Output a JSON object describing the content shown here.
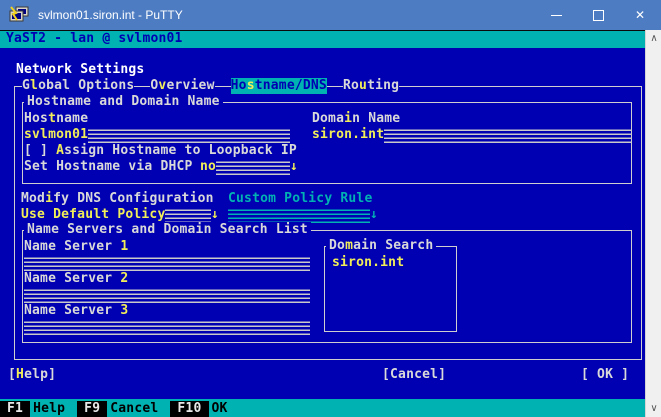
{
  "colors": {
    "titlebar": "#4d7cc2",
    "terminal_bg": "#0000b2",
    "cyan": "#00b2b2",
    "yellow": "#f2ee58",
    "text_white": "#d9d9d9",
    "scrollbar": "#f0f0f0"
  },
  "titlebar": {
    "title": "svlmon01.siron.int - PuTTY",
    "minimize": "minimize",
    "maximize": "maximize",
    "close": "✕"
  },
  "glyphs": {
    "dropdown": "↓",
    "scroll_up": "∧",
    "scroll_down": "∨"
  },
  "yast": {
    "header": "YaST2 - lan @ svlmon01",
    "heading": "Network Settings",
    "tabs": [
      {
        "pre": "G",
        "hot": "l",
        "post": "obal Options",
        "selected": false
      },
      {
        "pre": "O",
        "hot": "v",
        "post": "erview",
        "selected": false
      },
      {
        "pre": "Ho",
        "hot": "s",
        "post": "tname/DNS",
        "selected": true
      },
      {
        "pre": "Ro",
        "hot": "u",
        "post": "ting",
        "selected": false
      }
    ],
    "host_box": {
      "title": "Hostname and Domain Name",
      "hostname_label": {
        "pre": "Hos",
        "hot": "t",
        "post": "name"
      },
      "hostname_value": "svlmon01",
      "domain_label": {
        "pre": "Doma",
        "hot": "i",
        "post": "n Name"
      },
      "domain_value": "siron.int",
      "loopback_checkbox": {
        "box": "[ ] ",
        "hot": "A",
        "post": "ssign Hostname to Loopback IP",
        "checked": false
      },
      "dhcp_label": "Set Hostname via DHCP",
      "dhcp_value": "no"
    },
    "dns": {
      "modify_label": {
        "pre": "Mod",
        "hot": "i",
        "post": "fy DNS Configuration"
      },
      "policy_value": "Use Default Policy",
      "custom_label": "Custom Policy Rule",
      "custom_value": ""
    },
    "ns_box": {
      "title": "Name Servers and Domain Search List",
      "servers": [
        {
          "pre": "Name Server ",
          "hot": "1",
          "value": ""
        },
        {
          "pre": "Name Server ",
          "hot": "2",
          "value": ""
        },
        {
          "pre": "Name Server ",
          "hot": "3",
          "value": ""
        }
      ],
      "domain_search": {
        "title": {
          "pre": "Do",
          "hot": "m",
          "post": "ain Search"
        },
        "entries": [
          "siron.int"
        ]
      }
    },
    "buttons": {
      "help": {
        "pre": "[",
        "hot": "H",
        "post": "elp]"
      },
      "cancel": "[Cancel]",
      "ok": "[ OK ]"
    },
    "fkeys": [
      {
        "key": "F1",
        "label": "Help"
      },
      {
        "key": "F9",
        "label": "Cancel"
      },
      {
        "key": "F10",
        "label": "OK"
      }
    ]
  }
}
